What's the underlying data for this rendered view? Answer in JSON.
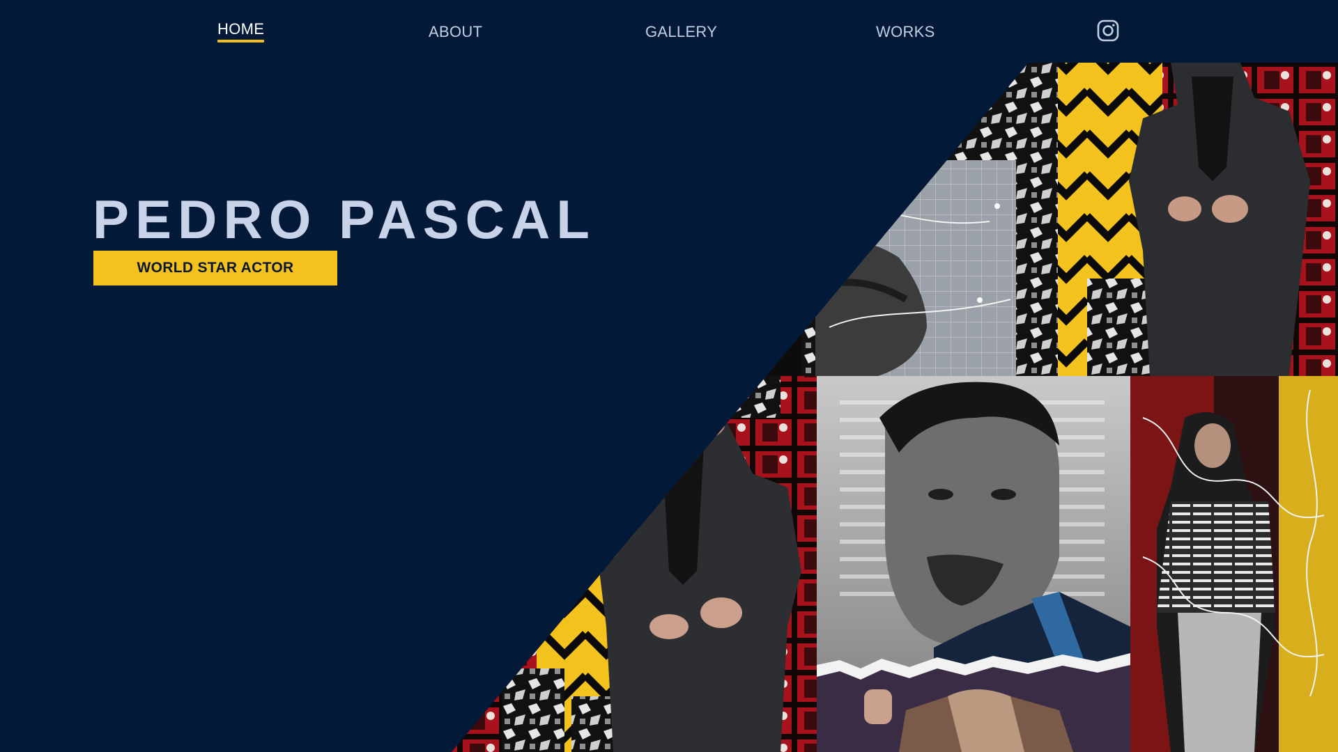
{
  "nav": {
    "items": [
      {
        "label": "HOME",
        "active": true
      },
      {
        "label": "ABOUT",
        "active": false
      },
      {
        "label": "GALLERY",
        "active": false
      },
      {
        "label": "WORKS",
        "active": false
      }
    ],
    "social_icon": "instagram-icon"
  },
  "hero": {
    "title": "PEDRO PASCAL",
    "subtitle": "WORLD STAR ACTOR"
  },
  "colors": {
    "background": "#021a38",
    "accent": "#f4c21c",
    "title": "#c8d3ea",
    "nav_text": "#c3cfe4"
  },
  "collage": {
    "panels": [
      "close-up-profile-photo",
      "yellow-chevron-suit-photo",
      "suit-buttoning-photo",
      "portrait-closeup-photo",
      "torn-paper-photo",
      "patterned-sweater-photo"
    ]
  }
}
